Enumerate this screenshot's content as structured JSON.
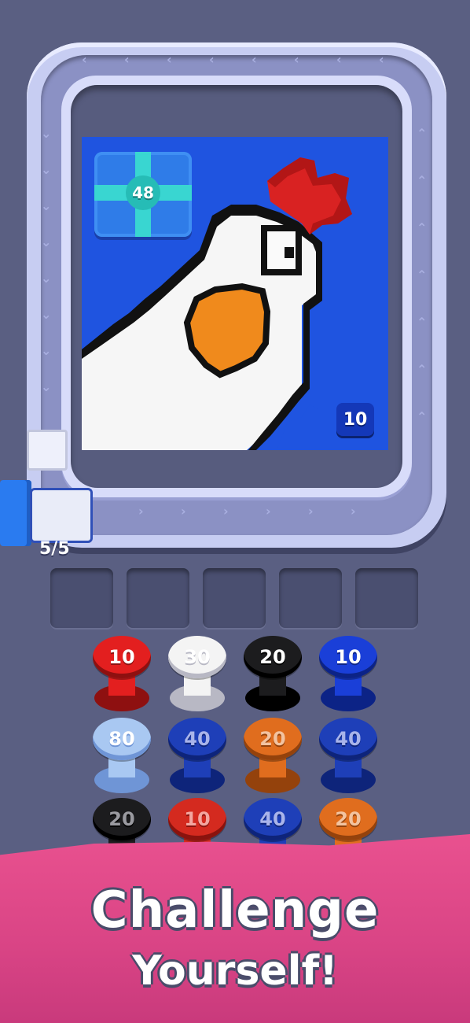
{
  "board": {
    "gift_count": "48",
    "tile_badge": "10",
    "spool_counter": "5/5"
  },
  "slots": 5,
  "spools": [
    {
      "label": "10",
      "color": "#e31f1f",
      "dark": "#8e1010",
      "text": "#ffffff"
    },
    {
      "label": "30",
      "color": "#f4f4f4",
      "dark": "#b8b8c4",
      "text": "#ffffff"
    },
    {
      "label": "20",
      "color": "#1c1c1e",
      "dark": "#000000",
      "text": "#ffffff"
    },
    {
      "label": "10",
      "color": "#1a3fd8",
      "dark": "#0c2386",
      "text": "#ffffff"
    },
    {
      "label": "80",
      "color": "#a9c8f2",
      "dark": "#6f95d6",
      "text": "#ffffff"
    },
    {
      "label": "40",
      "color": "#1e3fb8",
      "dark": "#0e247a",
      "text": "#a9b4ea"
    },
    {
      "label": "20",
      "color": "#e06d1e",
      "dark": "#94420c",
      "text": "#f2c3a0"
    },
    {
      "label": "40",
      "color": "#1e3fb8",
      "dark": "#0e247a",
      "text": "#a9b4ea"
    },
    {
      "label": "20",
      "color": "#1c1c1e",
      "dark": "#000000",
      "text": "#9a9aa0"
    },
    {
      "label": "10",
      "color": "#d42a1f",
      "dark": "#8a130e",
      "text": "#f3a6a0"
    },
    {
      "label": "40",
      "color": "#1e3fb8",
      "dark": "#0e247a",
      "text": "#a9b4ea"
    },
    {
      "label": "20",
      "color": "#e06d1e",
      "dark": "#94420c",
      "text": "#f2c3a0"
    }
  ],
  "banner": {
    "line1": "Challenge",
    "line2": "Yourself!"
  },
  "icons": [
    "gift-icon",
    "arrow-left-icon",
    "arrow-down-icon",
    "arrow-right-icon",
    "spool-icon"
  ]
}
